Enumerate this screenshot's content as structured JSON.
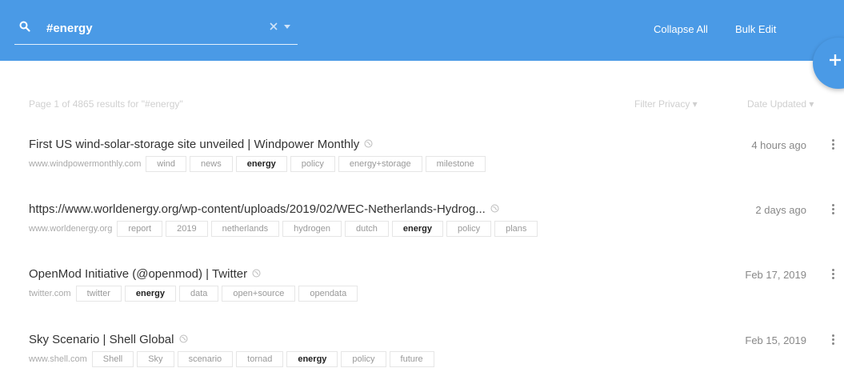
{
  "search": {
    "value": "#energy"
  },
  "topbar": {
    "collapse_all": "Collapse All",
    "bulk_edit": "Bulk Edit"
  },
  "fab": {
    "icon": "plus-icon"
  },
  "results": {
    "summary": "Page 1 of 4865 results for \"#energy\"",
    "filter_privacy": "Filter Privacy ▾",
    "date_updated": "Date Updated ▾"
  },
  "items": [
    {
      "title": "First US wind-solar-storage site unveiled | Windpower Monthly",
      "domain": "www.windpowermonthly.com",
      "date": "4 hours ago",
      "tags": [
        "wind",
        "news",
        "energy",
        "policy",
        "energy+storage",
        "milestone"
      ]
    },
    {
      "title": "https://www.worldenergy.org/wp-content/uploads/2019/02/WEC-Netherlands-Hydrog...",
      "domain": "www.worldenergy.org",
      "date": "2 days ago",
      "tags": [
        "report",
        "2019",
        "netherlands",
        "hydrogen",
        "dutch",
        "energy",
        "policy",
        "plans"
      ]
    },
    {
      "title": "OpenMod Initiative (@openmod) | Twitter",
      "domain": "twitter.com",
      "date": "Feb 17, 2019",
      "tags": [
        "twitter",
        "energy",
        "data",
        "open+source",
        "opendata"
      ]
    },
    {
      "title": "Sky Scenario | Shell Global",
      "domain": "www.shell.com",
      "date": "Feb 15, 2019",
      "tags": [
        "Shell",
        "Sky",
        "scenario",
        "tornad",
        "energy",
        "policy",
        "future"
      ]
    }
  ],
  "active_tag": "energy",
  "colors": {
    "accent": "#4a9ae6"
  }
}
